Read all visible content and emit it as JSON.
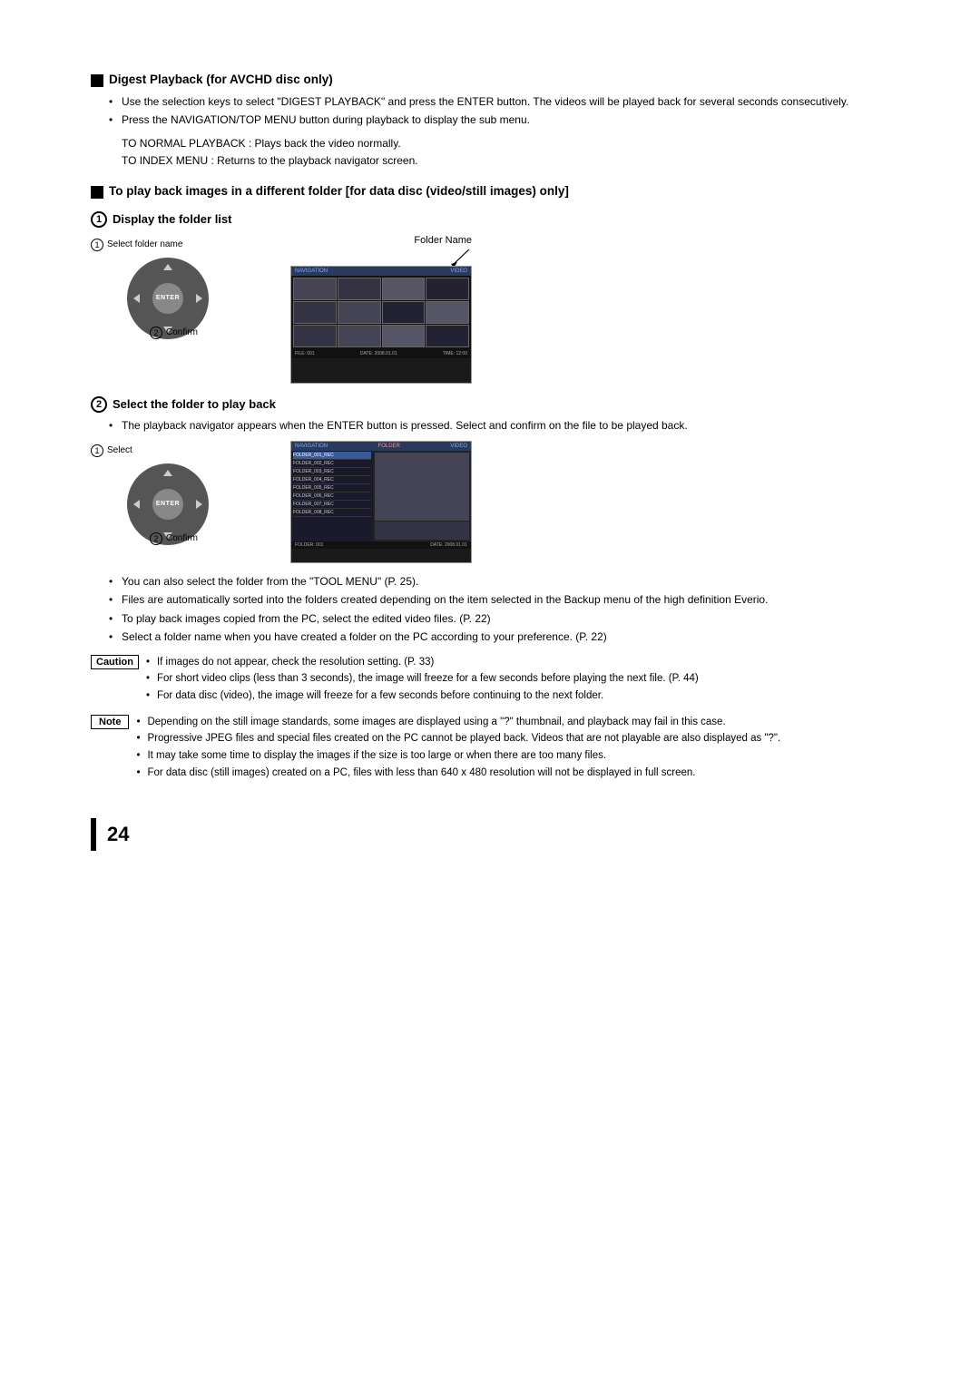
{
  "page": {
    "number": "24"
  },
  "sections": {
    "digest_playback": {
      "heading": "Digest Playback (for AVCHD disc only)",
      "bullets": [
        "Use the selection keys to select \"DIGEST PLAYBACK\" and press the ENTER button. The videos will be played back for several seconds consecutively.",
        "Press the NAVIGATION/TOP MENU button during playback to display the sub menu."
      ],
      "indent_items": [
        "TO NORMAL PLAYBACK : Plays back the video normally.",
        "TO INDEX MENU        : Returns to the playback navigator screen."
      ]
    },
    "different_folder": {
      "heading": "To play back images in a different folder [for data disc (video/still images) only]"
    },
    "step1": {
      "number": "1",
      "heading": "Display the folder list",
      "sub_label1": "Select folder name",
      "sub_label2": "Confirm",
      "folder_name_label": "Folder Name"
    },
    "step2": {
      "number": "2",
      "heading": "Select the folder to play back",
      "description_bullets": [
        "The playback navigator appears when the ENTER button is pressed. Select and confirm on the file to be played back."
      ],
      "sub_label1": "Select",
      "sub_label2": "Confirm"
    },
    "general_bullets": [
      "You can also select the folder from the \"TOOL MENU\" (P. 25).",
      "Files are automatically sorted into the folders created depending on the item selected in the Backup menu of the high definition Everio.",
      "To play back images copied from the PC, select the edited video files. (P. 22)",
      "Select a folder name when you have created a folder on the PC according to your preference. (P. 22)"
    ],
    "caution": {
      "label": "Caution",
      "items": [
        "If images do not appear, check the resolution setting. (P. 33)",
        "For short video clips (less than 3 seconds), the image will freeze for a few seconds before playing the next file. (P. 44)",
        "For data disc (video), the image will freeze for a few seconds before continuing to the next folder."
      ]
    },
    "note": {
      "label": "Note",
      "items": [
        "Depending on the still image standards, some images are displayed using a \"?\" thumbnail, and playback may fail in this case.",
        "Progressive JPEG files and special files created on the PC cannot be played back. Videos that are not playable are also displayed as \"?\".",
        "It may take some time to display the images if the size is too large or when there are too many files.",
        "For data disc (still images) created on a PC, files with less than 640 x 480 resolution will not be displayed in full screen."
      ]
    }
  }
}
